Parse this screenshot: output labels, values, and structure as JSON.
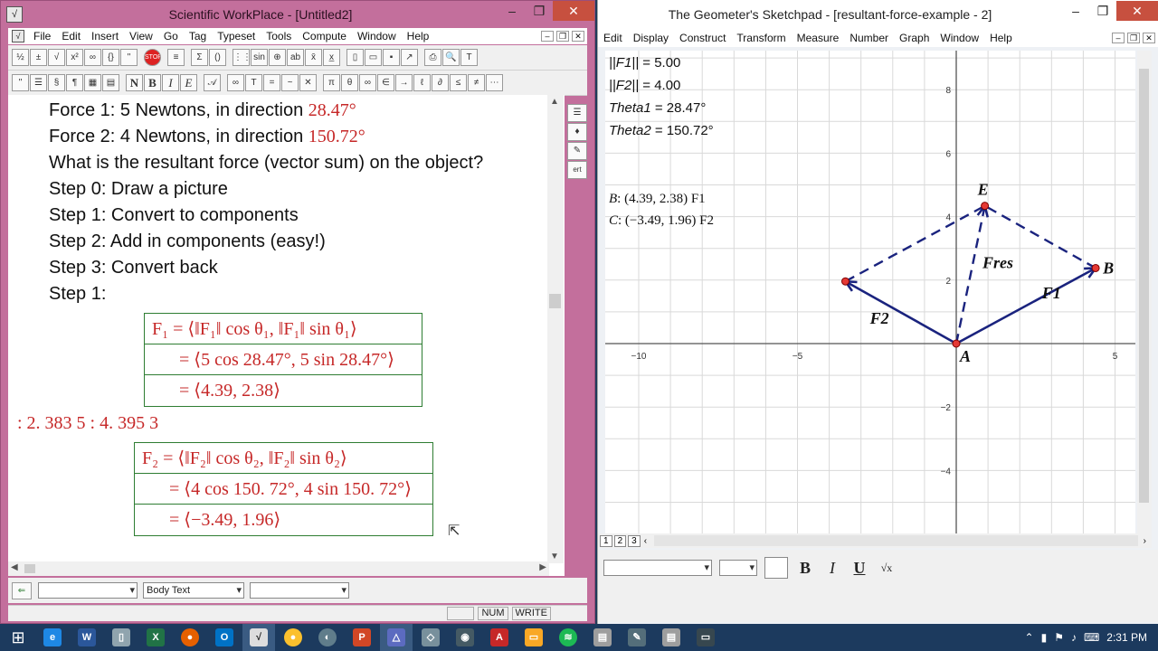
{
  "swp": {
    "title": "Scientific WorkPlace - [Untitled2]",
    "menu": [
      "File",
      "Edit",
      "Insert",
      "View",
      "Go",
      "Tag",
      "Typeset",
      "Tools",
      "Compute",
      "Window",
      "Help"
    ],
    "lines": [
      {
        "text": "Force 1: 5 Newtons, in direction ",
        "angle": "28.47°"
      },
      {
        "text": "Force 2: 4 Newtons, in direction ",
        "angle": "150.72°"
      },
      {
        "text": "What is the resultant force (vector sum) on the object?"
      },
      {
        "text": "Step 0: Draw a picture"
      },
      {
        "text": "Step 1: Convert to components"
      },
      {
        "text": "Step 2: Add in components (easy!)"
      },
      {
        "text": "Step 3: Convert back"
      },
      {
        "text": "Step 1:"
      }
    ],
    "eq1": [
      "F₁ = ⟨‖F₁‖ cos θ₁, ‖F₁‖ sin θ₁⟩",
      "= ⟨5 cos 28.47°, 5 sin 28.47°⟩",
      "= ⟨4.39, 2.38⟩"
    ],
    "result_line": ": 2. 383 5  : 4. 395 3",
    "eq2": [
      "F₂ = ⟨‖F₂‖ cos θ₂, ‖F₂‖ sin θ₂⟩",
      "= ⟨4 cos 150. 72°, 4 sin 150. 72°⟩",
      "= ⟨−3.49, 1.96⟩"
    ],
    "style_combo": "Body Text",
    "status": [
      "NUM",
      "WRITE"
    ]
  },
  "gsp": {
    "title": "The Geometer's Sketchpad - [resultant-force-example - 2]",
    "menu": [
      "Edit",
      "Display",
      "Construct",
      "Transform",
      "Measure",
      "Number",
      "Graph",
      "Window",
      "Help"
    ],
    "measurements": [
      {
        "label": "||F1||",
        "value": " = 5.00"
      },
      {
        "label": "||F2||",
        "value": " = 4.00"
      },
      {
        "label": "Theta1",
        "value": " = 28.47°"
      },
      {
        "label": "Theta2",
        "value": " = 150.72°"
      }
    ],
    "coords": [
      {
        "point": "B",
        "text": ": (4.39, 2.38)  F1"
      },
      {
        "point": "C",
        "text": ": (−3.49, 1.96)  F2"
      }
    ],
    "tabs": [
      "1",
      "2",
      "3"
    ],
    "format_buttons": [
      "B",
      "I",
      "U"
    ]
  },
  "chart_data": {
    "type": "scatter",
    "xlim": [
      -10.5,
      5.5
    ],
    "ylim": [
      -5.7,
      9.5
    ],
    "x_ticks": [
      -10,
      -5,
      5
    ],
    "y_ticks": [
      -4,
      -2,
      2,
      4,
      6,
      8
    ],
    "grid": true,
    "points": [
      {
        "name": "A",
        "x": 0,
        "y": 0
      },
      {
        "name": "B",
        "x": 4.39,
        "y": 2.38
      },
      {
        "name": "C",
        "x": -3.49,
        "y": 1.96
      },
      {
        "name": "E",
        "x": 0.9,
        "y": 4.34
      }
    ],
    "segments": [
      {
        "from": "A",
        "to": "B",
        "label": "F1",
        "style": "solid"
      },
      {
        "from": "A",
        "to": "C",
        "label": "F2",
        "style": "solid"
      },
      {
        "from": "A",
        "to": "E",
        "label": "Fres",
        "style": "dashed"
      },
      {
        "from": "B",
        "to": "E",
        "label": "",
        "style": "dashed"
      },
      {
        "from": "C",
        "to": "E",
        "label": "",
        "style": "dashed"
      }
    ]
  },
  "taskbar": {
    "time": "2:31 PM"
  },
  "colors": {
    "swp_frame": "#c36f9c",
    "equation_red": "#c62828",
    "box_green": "#2e7d32",
    "vector_navy": "#1a237e"
  }
}
